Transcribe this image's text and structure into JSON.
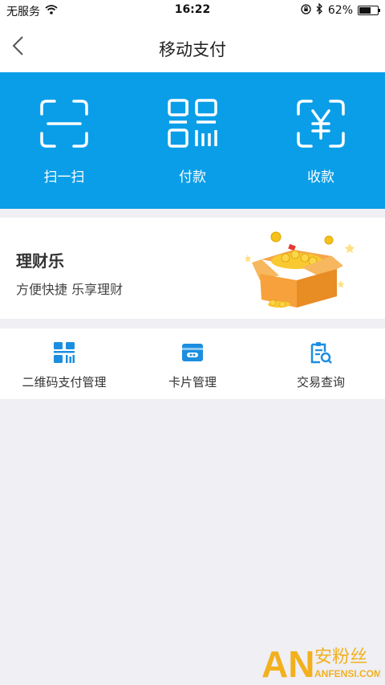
{
  "status_bar": {
    "carrier": "无服务",
    "time": "16:22",
    "battery_percent": "62%",
    "battery_level": 0.62
  },
  "nav": {
    "title": "移动支付"
  },
  "actions": [
    {
      "label": "扫一扫",
      "icon": "scan-icon"
    },
    {
      "label": "付款",
      "icon": "pay-code-icon"
    },
    {
      "label": "收款",
      "icon": "receive-money-icon"
    }
  ],
  "promo": {
    "title": "理财乐",
    "subtitle": "方便快捷   乐享理财"
  },
  "tools": [
    {
      "label": "二维码支付管理",
      "icon": "qr-manage-icon"
    },
    {
      "label": "卡片管理",
      "icon": "card-icon"
    },
    {
      "label": "交易查询",
      "icon": "transaction-search-icon"
    }
  ],
  "watermark": {
    "logo_text": "AN",
    "cn_text": "安粉丝",
    "en_text": "ANFENSI.COM"
  },
  "colors": {
    "primary": "#0a9ee8",
    "background": "#efeff4"
  }
}
